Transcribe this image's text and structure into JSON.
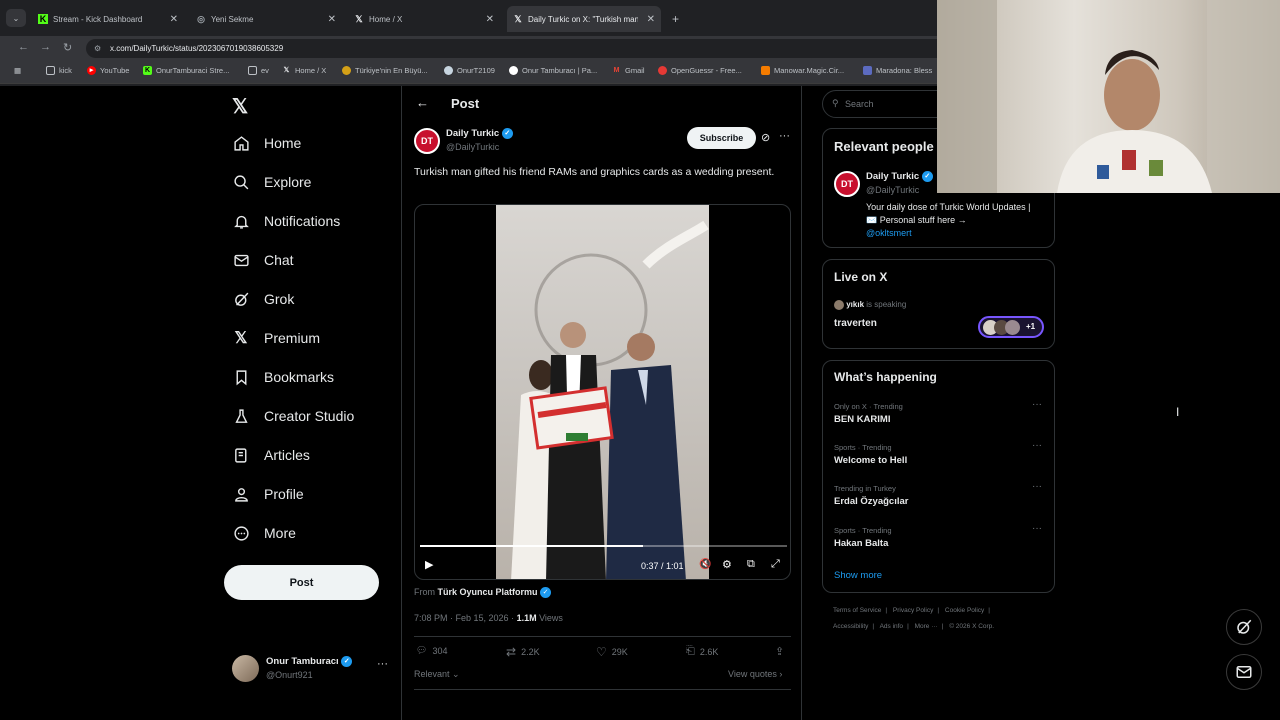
{
  "browser": {
    "tabs": [
      {
        "label": "Stream - Kick Dashboard",
        "icon": "kick-icon"
      },
      {
        "label": "Yeni Sekme",
        "icon": "globe-icon"
      },
      {
        "label": "Home / X",
        "icon": "x-logo-icon"
      },
      {
        "label": "Daily Turkic on X: \"Turkish man",
        "icon": "x-logo-icon"
      }
    ],
    "url": "x.com/DailyTurkic/status/2023067019038605329",
    "bookmarks": [
      {
        "label": "kick",
        "icon": "folder-icon"
      },
      {
        "label": "YouTube",
        "icon": "youtube-icon"
      },
      {
        "label": "OnurTamburaci Stre...",
        "icon": "kick-icon"
      },
      {
        "label": "ev",
        "icon": "folder-icon"
      },
      {
        "label": "Home / X",
        "icon": "x-logo-icon"
      },
      {
        "label": "Türkiye'nin En Büyü...",
        "icon": "site-icon"
      },
      {
        "label": "OnurT2109",
        "icon": "steam-icon"
      },
      {
        "label": "Onur Tamburacı | Pa...",
        "icon": "patreon-icon"
      },
      {
        "label": "Gmail",
        "icon": "gmail-icon"
      },
      {
        "label": "OpenGuessr - Free...",
        "icon": "map-pin-icon"
      },
      {
        "label": "Manowar.Magic.Cir...",
        "icon": "site-icon"
      },
      {
        "label": "Maradona: Bless",
        "icon": "site-icon"
      }
    ]
  },
  "nav": {
    "items": [
      {
        "label": "Home",
        "icon": "home-icon"
      },
      {
        "label": "Explore",
        "icon": "search-icon"
      },
      {
        "label": "Notifications",
        "icon": "bell-icon"
      },
      {
        "label": "Chat",
        "icon": "mail-icon"
      },
      {
        "label": "Grok",
        "icon": "grok-icon"
      },
      {
        "label": "Premium",
        "icon": "x-logo-icon"
      },
      {
        "label": "Bookmarks",
        "icon": "bookmark-icon"
      },
      {
        "label": "Creator Studio",
        "icon": "flask-icon"
      },
      {
        "label": "Articles",
        "icon": "article-icon"
      },
      {
        "label": "Profile",
        "icon": "person-icon"
      },
      {
        "label": "More",
        "icon": "more-circle-icon"
      }
    ],
    "post_label": "Post",
    "account": {
      "name": "Onur Tamburacı",
      "handle": "@Onurt921"
    }
  },
  "post": {
    "header_title": "Post",
    "author": {
      "name": "Daily Turkic",
      "handle": "@DailyTurkic",
      "avatar_text": "DT"
    },
    "subscribe_label": "Subscribe",
    "text": "Turkish man gifted his friend RAMs and graphics cards as a wedding present.",
    "video": {
      "time": "0:37 / 1:01",
      "progress": 0.607
    },
    "from_prefix": "From",
    "from_source": "Türk Oyuncu Platformu",
    "timestamp": "7:08 PM · Feb 15, 2026 · ",
    "views_count": "1.1M",
    "views_label": " Views",
    "stats": {
      "replies": "304",
      "reposts": "2.2K",
      "likes": "29K",
      "bookmarks": "2.6K"
    },
    "sort_label": "Relevant",
    "view_quotes": "View quotes"
  },
  "sidebar": {
    "search_placeholder": "Search",
    "relevant": {
      "title": "Relevant people",
      "name": "Daily Turkic",
      "handle": "@DailyTurkic",
      "bio": "Your daily dose of Turkic World Updates | ✉️ Personal stuff here →",
      "bio_link": "@okltsmert"
    },
    "live": {
      "title": "Live on X",
      "speaker": "yıkık",
      "speaking": " is speaking",
      "space": "traverten",
      "more": "+1"
    },
    "happening": {
      "title": "What’s happening",
      "trends": [
        {
          "meta": "Only on X · Trending",
          "topic": "BEN KARIMI"
        },
        {
          "meta": "Sports · Trending",
          "topic": "Welcome to Hell"
        },
        {
          "meta": "Trending in Turkey",
          "topic": "Erdal Özyağcılar"
        },
        {
          "meta": "Sports · Trending",
          "topic": "Hakan Balta"
        }
      ],
      "show_more": "Show more"
    },
    "footer": {
      "links": [
        "Terms of Service",
        "Privacy Policy",
        "Cookie Policy",
        "Accessibility",
        "Ads info",
        "More ···"
      ],
      "copyright": "© 2026 X Corp."
    }
  }
}
